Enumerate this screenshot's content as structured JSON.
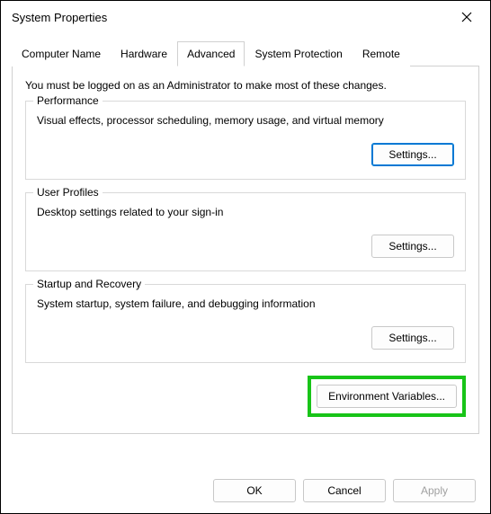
{
  "window": {
    "title": "System Properties"
  },
  "tabs": {
    "items": [
      {
        "label": "Computer Name"
      },
      {
        "label": "Hardware"
      },
      {
        "label": "Advanced"
      },
      {
        "label": "System Protection"
      },
      {
        "label": "Remote"
      }
    ],
    "activeIndex": 2
  },
  "panel": {
    "intro": "You must be logged on as an Administrator to make most of these changes.",
    "groups": {
      "performance": {
        "legend": "Performance",
        "desc": "Visual effects, processor scheduling, memory usage, and virtual memory",
        "button": "Settings..."
      },
      "userProfiles": {
        "legend": "User Profiles",
        "desc": "Desktop settings related to your sign-in",
        "button": "Settings..."
      },
      "startupRecovery": {
        "legend": "Startup and Recovery",
        "desc": "System startup, system failure, and debugging information",
        "button": "Settings..."
      }
    },
    "envButton": "Environment Variables..."
  },
  "footer": {
    "ok": "OK",
    "cancel": "Cancel",
    "apply": "Apply"
  }
}
